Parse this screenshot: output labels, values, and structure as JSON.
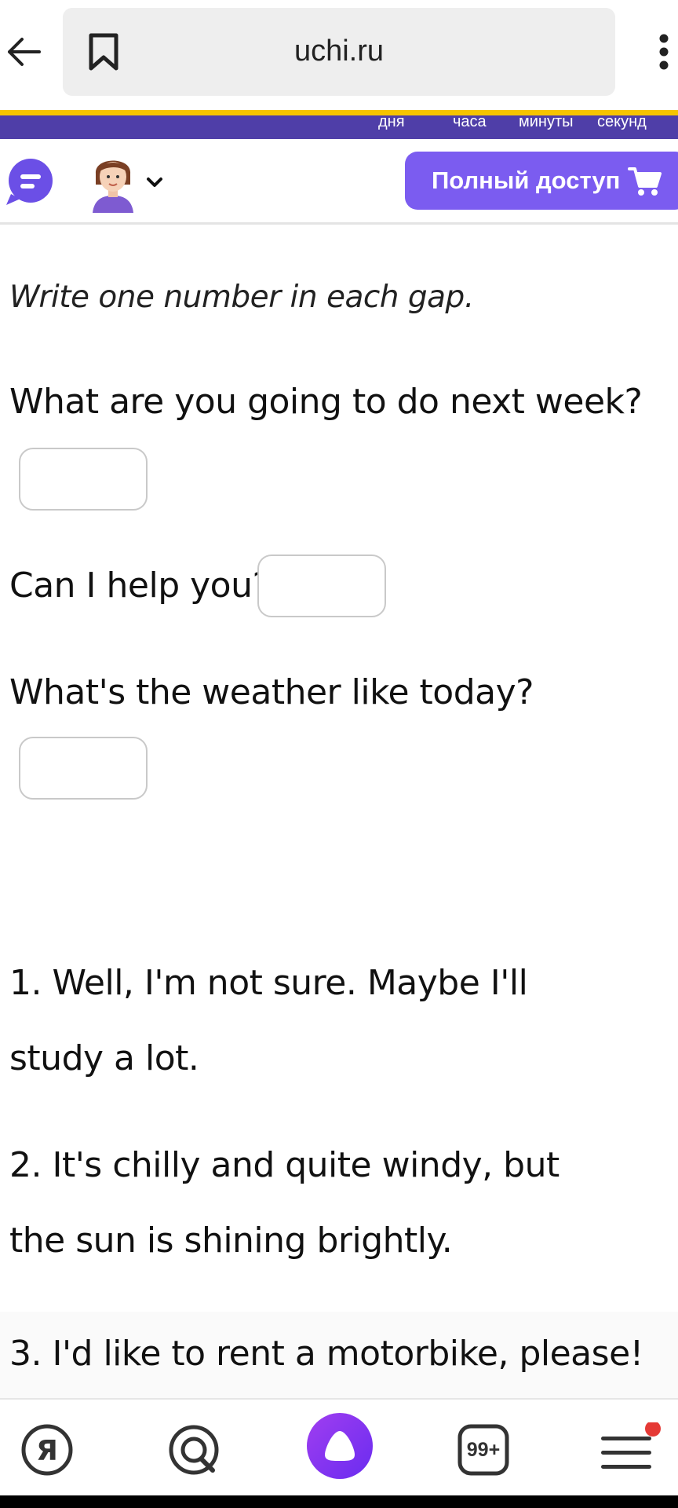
{
  "browser": {
    "url": "uchi.ru",
    "icons": [
      "arrow-left-icon",
      "bookmark-icon",
      "kebab-menu-icon"
    ]
  },
  "timer": {
    "labels": [
      "дня",
      "часа",
      "минуты",
      "секунд"
    ],
    "colors": {
      "band": "#4f3ea8",
      "accent": "#f6c400"
    }
  },
  "header": {
    "full_access_label": "Полный доступ",
    "accent": "#7b5cf0"
  },
  "exercise": {
    "instruction": "Write one number in each gap.",
    "questions": [
      {
        "text": "What are you going to do next week?",
        "answer": ""
      },
      {
        "text": "Can I help you?",
        "answer": ""
      },
      {
        "text": "What's the weather like today?",
        "answer": ""
      }
    ],
    "answers": [
      "1. Well, I'm not sure. Maybe I'll study a lot.",
      "2. It's chilly and quite windy, but the sun is shining brightly.",
      "3. I'd like to rent a motorbike, please!"
    ]
  },
  "bottom_nav": {
    "tabs_badge": "99+",
    "icons": [
      "yandex-icon",
      "alice-search-icon",
      "alice-assistant-icon",
      "tabs-icon",
      "menu-icon"
    ],
    "notification_color": "#e53935"
  }
}
